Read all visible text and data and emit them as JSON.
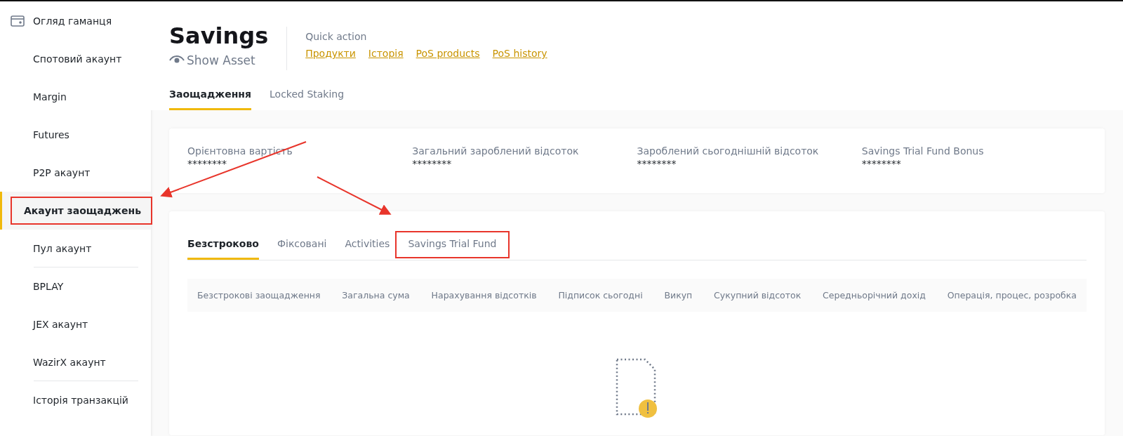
{
  "sidebar": {
    "items": [
      {
        "label": "Огляд гаманця",
        "kind": "wallet",
        "selected": false,
        "highlighted": false,
        "divider_after": false
      },
      {
        "label": "Спотовий акаунт",
        "kind": "plain",
        "selected": false,
        "highlighted": false,
        "divider_after": false
      },
      {
        "label": "Margin",
        "kind": "plain",
        "selected": false,
        "highlighted": false,
        "divider_after": false
      },
      {
        "label": "Futures",
        "kind": "plain",
        "selected": false,
        "highlighted": false,
        "divider_after": false
      },
      {
        "label": "P2P акаунт",
        "kind": "plain",
        "selected": false,
        "highlighted": false,
        "divider_after": false
      },
      {
        "label": "Акаунт заощаджень",
        "kind": "plain",
        "selected": true,
        "highlighted": true,
        "divider_after": false
      },
      {
        "label": "Пул акаунт",
        "kind": "plain",
        "selected": false,
        "highlighted": false,
        "divider_after": true
      },
      {
        "label": "BPLAY",
        "kind": "plain",
        "selected": false,
        "highlighted": false,
        "divider_after": false
      },
      {
        "label": "JEX акаунт",
        "kind": "plain",
        "selected": false,
        "highlighted": false,
        "divider_after": false
      },
      {
        "label": "WazirX акаунт",
        "kind": "plain",
        "selected": false,
        "highlighted": false,
        "divider_after": true
      },
      {
        "label": "Історія транзакцій",
        "kind": "plain",
        "selected": false,
        "highlighted": false,
        "divider_after": false
      }
    ]
  },
  "header": {
    "title": "Savings",
    "show_asset": "Show Asset",
    "quick_action": {
      "label": "Quick action",
      "links": [
        "Продукти",
        "Історія",
        "PoS products",
        "PoS history"
      ]
    }
  },
  "tabs": [
    {
      "label": "Заощадження",
      "selected": true
    },
    {
      "label": "Locked Staking",
      "selected": false
    }
  ],
  "summary": [
    {
      "label": "Орієнтовна вартість",
      "value": "********"
    },
    {
      "label": "Загальний зароблений відсоток",
      "value": "********"
    },
    {
      "label": "Зароблений сьогоднішній відсоток",
      "value": "********"
    },
    {
      "label": "Savings Trial Fund Bonus",
      "value": "********"
    }
  ],
  "sub_tabs": [
    {
      "label": "Безстроково",
      "selected": true,
      "highlighted": false
    },
    {
      "label": "Фіксовані",
      "selected": false,
      "highlighted": false
    },
    {
      "label": "Activities",
      "selected": false,
      "highlighted": false
    },
    {
      "label": "Savings Trial Fund",
      "selected": false,
      "highlighted": true
    }
  ],
  "table": {
    "columns": [
      "Безстрокові заощадження",
      "Загальна сума",
      "Нарахування відсотків",
      "Підписок сьогодні",
      "Викуп",
      "Сукупний відсоток",
      "Середньорічний дохід",
      "Операція, процес, розробка"
    ]
  }
}
